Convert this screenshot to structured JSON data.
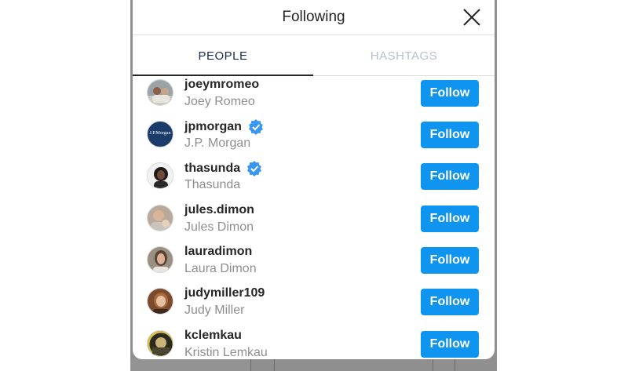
{
  "modal": {
    "title": "Following",
    "close_icon": "close-icon"
  },
  "tabs": [
    {
      "label": "PEOPLE",
      "active": true
    },
    {
      "label": "HASHTAGS",
      "active": false
    }
  ],
  "accounts": [
    {
      "username": "joeymromeo",
      "full_name": "Joey Romeo",
      "verified": false,
      "button": "Follow"
    },
    {
      "username": "jpmorgan",
      "full_name": "J.P. Morgan",
      "verified": true,
      "button": "Follow",
      "avatar_text": "J.P.Morgan"
    },
    {
      "username": "thasunda",
      "full_name": "Thasunda",
      "verified": true,
      "button": "Follow"
    },
    {
      "username": "jules.dimon",
      "full_name": "Jules Dimon",
      "verified": false,
      "button": "Follow"
    },
    {
      "username": "lauradimon",
      "full_name": "Laura Dimon",
      "verified": false,
      "button": "Follow"
    },
    {
      "username": "judymiller109",
      "full_name": "Judy Miller",
      "verified": false,
      "button": "Follow"
    },
    {
      "username": "kclemkau",
      "full_name": "Kristin Lemkau",
      "verified": false,
      "button": "Follow"
    }
  ],
  "colors": {
    "follow_button": "#0f95f0",
    "verified_badge": "#3897f0",
    "active_tab_text": "#1c2a4a",
    "inactive_tab_text": "#b6c1cf"
  }
}
